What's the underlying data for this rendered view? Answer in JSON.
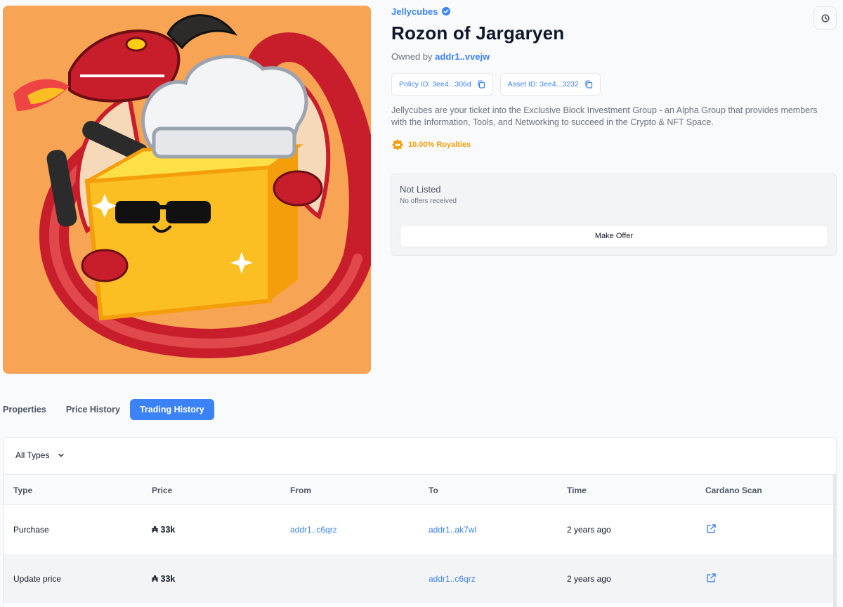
{
  "collection": {
    "name": "Jellycubes",
    "icon": "verified-badge-icon"
  },
  "title": "Rozon of Jargaryen",
  "owner": {
    "prefix": "Owned by",
    "address": "addr1..vvejw"
  },
  "ids": {
    "policy": "Policy ID: 3ee4...306d",
    "asset": "Asset ID: 3ee4...3232"
  },
  "description": "Jellycubes are your ticket into the Exclusive Block Investment Group - an Alpha Group that provides members with the Information, Tools, and Networking to succeed in the Crypto & NFT Space.",
  "royalties": "10.00% Royalties",
  "listing": {
    "status": "Not Listed",
    "offers": "No offers received",
    "button": "Make Offer"
  },
  "tabs": [
    "Properties",
    "Price History",
    "Trading History"
  ],
  "active_tab": "Trading History",
  "filter": {
    "selected": "All Types"
  },
  "table": {
    "headers": [
      "Type",
      "Price",
      "From",
      "To",
      "Time",
      "Cardano Scan"
    ],
    "rows": [
      {
        "type": "Purchase",
        "price": "₳ 33k",
        "from": "addr1..c6qrz",
        "to": "addr1..ak7wl",
        "time": "2 years ago"
      },
      {
        "type": "Update price",
        "price": "₳ 33k",
        "from": "",
        "to": "addr1..c6qrz",
        "time": "2 years ago"
      }
    ]
  },
  "colors": {
    "accent": "#3b82f6",
    "royalty": "#f59e0b",
    "image_bg": "#f8a455"
  }
}
